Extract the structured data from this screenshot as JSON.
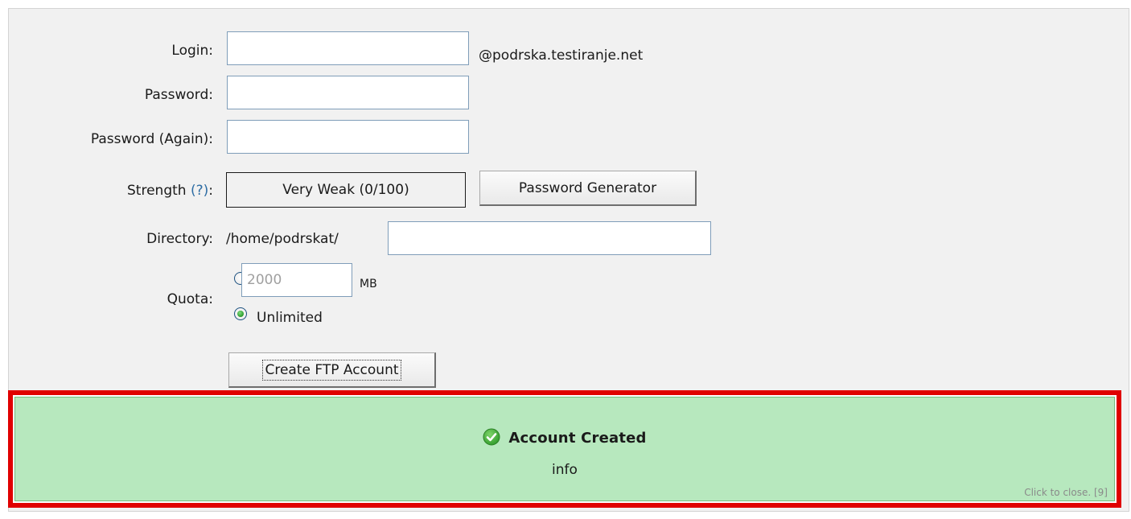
{
  "form": {
    "login": {
      "label": "Login:",
      "value": "",
      "domain_suffix": "@podrska.testiranje.net"
    },
    "password": {
      "label": "Password:",
      "value": ""
    },
    "password_again": {
      "label": "Password (Again):",
      "value": ""
    },
    "strength": {
      "label": "Strength",
      "help_link": "(?)",
      "colon": ":",
      "value_text": "Very Weak (0/100)"
    },
    "password_generator_button": "Password Generator",
    "directory": {
      "label": "Directory:",
      "prefix": "/home/podrskat/",
      "value": ""
    },
    "quota": {
      "label": "Quota:",
      "limited_value": "2000",
      "unit": "MB",
      "unlimited_label": "Unlimited",
      "selected": "unlimited"
    },
    "create_button": "Create FTP Account"
  },
  "notification": {
    "title": "Account Created",
    "message": "info",
    "close_hint": "Click to close. [9]",
    "status": "success",
    "highlight_color": "#e00000",
    "background_color": "#b7e8be",
    "icon": "check-circle-icon"
  }
}
